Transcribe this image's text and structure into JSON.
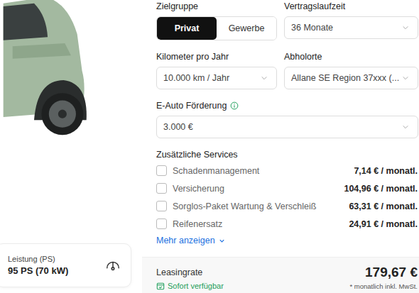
{
  "spec_card": {
    "label": "Leistung (PS)",
    "value": "95 PS (70 kW)"
  },
  "fields": [
    {
      "label": "Zielgruppe",
      "kind": "toggle",
      "info": false,
      "options": [
        {
          "label": "Privat",
          "selected": true
        },
        {
          "label": "Gewerbe",
          "selected": false
        }
      ]
    },
    {
      "label": "Vertragslaufzeit",
      "kind": "select",
      "info": false,
      "value": "36 Monate"
    },
    {
      "label": "Kilometer pro Jahr",
      "kind": "select",
      "info": false,
      "value": "10.000 km / Jahr"
    },
    {
      "label": "Abholorte",
      "kind": "select",
      "info": false,
      "value": "Allane SE Region 37xxx (..."
    },
    {
      "label": "E-Auto Förderung",
      "kind": "select",
      "info": true,
      "value": "3.000 €"
    }
  ],
  "services": {
    "title": "Zusätzliche Services",
    "items": [
      {
        "label": "Schadenmanagement",
        "price": "7,14 € / monatl.",
        "checked": false
      },
      {
        "label": "Versicherung",
        "price": "104,96 € / monatl.",
        "checked": false
      },
      {
        "label": "Sorglos-Paket Wartung & Verschleiß",
        "price": "63,31 € / monatl.",
        "checked": false
      },
      {
        "label": "Reifenersatz",
        "price": "24,91 € / monatl.",
        "checked": false
      }
    ],
    "more": "Mehr anzeigen"
  },
  "summary": {
    "label": "Leasingrate",
    "price": "179,67 €",
    "availability": "Sofort verfügbar",
    "note": "* monatlich inkl. MwSt."
  }
}
